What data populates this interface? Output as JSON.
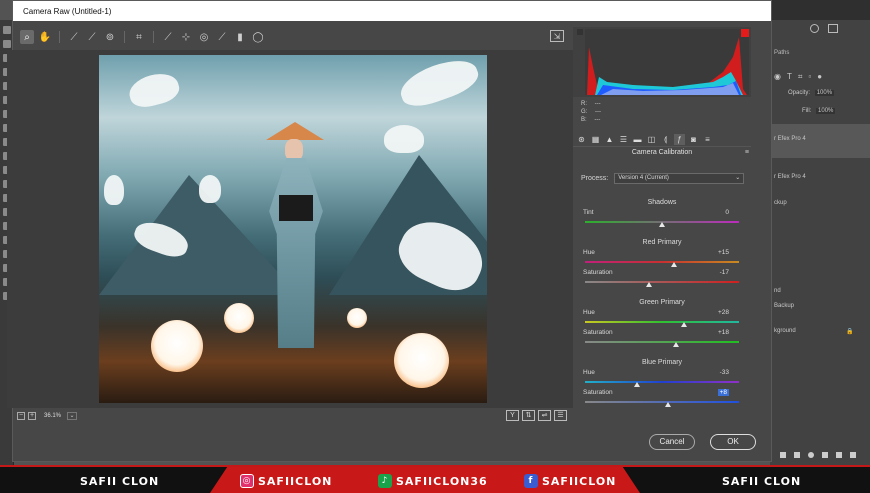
{
  "window": {
    "title": "Camera Raw (Untitled-1)"
  },
  "toolbar": {
    "tools": [
      "zoom-tool",
      "hand-tool",
      "white-balance-tool",
      "color-sampler-tool",
      "target-adjust-tool",
      "crop-tool",
      "straighten-tool",
      "spot-removal-tool",
      "red-eye-tool",
      "adjustment-brush-tool",
      "graduated-filter-tool",
      "radial-filter-tool"
    ]
  },
  "canvas": {
    "zoom": "36.1%"
  },
  "readout": {
    "r": "R:",
    "g": "G:",
    "b": "B:",
    "r_val": "---",
    "g_val": "---",
    "b_val": "---"
  },
  "panel": {
    "title": "Camera Calibration",
    "process_label": "Process:",
    "process_value": "Version 4 (Current)"
  },
  "sections": {
    "shadows": "Shadows",
    "red": "Red Primary",
    "green": "Green Primary",
    "blue": "Blue Primary"
  },
  "sliders": {
    "tint": {
      "label": "Tint",
      "value": "0",
      "level": 0.5
    },
    "red_hue": {
      "label": "Hue",
      "value": "+15",
      "level": 0.575
    },
    "red_sat": {
      "label": "Saturation",
      "value": "-17",
      "level": 0.415
    },
    "green_hue": {
      "label": "Hue",
      "value": "+28",
      "level": 0.64
    },
    "green_sat": {
      "label": "Saturation",
      "value": "+18",
      "level": 0.59
    },
    "blue_hue": {
      "label": "Hue",
      "value": "-33",
      "level": 0.335
    },
    "blue_sat": {
      "label": "Saturation",
      "value": "+8",
      "level": 0.54
    }
  },
  "buttons": {
    "cancel": "Cancel",
    "ok": "OK"
  },
  "photoshop": {
    "paths_label": "Paths",
    "opacity_label": "Opacity:",
    "opacity_value": "100%",
    "fill_label": "Fill:",
    "fill_value": "100%",
    "layers": [
      "r Efex Pro 4",
      "r Efex Pro 4",
      "ckup",
      "nd",
      "Backup",
      "kground"
    ]
  },
  "footer": {
    "left_name": "SAFII CLON",
    "instagram": "SAFIICLON",
    "tiktok": "SAFIICLON36",
    "facebook": "SAFIICLON",
    "right_name": "SAFII CLON"
  },
  "colors": {
    "accent_red": "#c81818",
    "highlight_blue": "#3a6fd8"
  }
}
